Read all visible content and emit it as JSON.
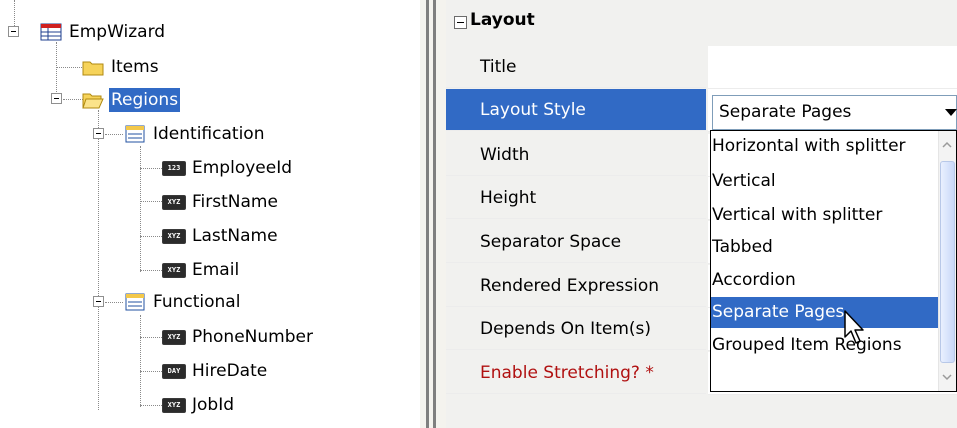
{
  "tree": {
    "root": {
      "label": "EmpWizard",
      "icon": "table-icon"
    },
    "items_node": {
      "label": "Items",
      "icon": "folder-icon"
    },
    "regions_node": {
      "label": "Regions",
      "icon": "open-folder-icon",
      "selected": true
    },
    "identification": {
      "label": "Identification",
      "icon": "region-icon",
      "children": [
        {
          "label": "EmployeeId",
          "badge": "123"
        },
        {
          "label": "FirstName",
          "badge": "XYZ"
        },
        {
          "label": "LastName",
          "badge": "XYZ"
        },
        {
          "label": "Email",
          "badge": "XYZ"
        }
      ]
    },
    "functional": {
      "label": "Functional",
      "icon": "region-icon",
      "children": [
        {
          "label": "PhoneNumber",
          "badge": "XYZ"
        },
        {
          "label": "HireDate",
          "badge": "DAY"
        },
        {
          "label": "JobId",
          "badge": "XYZ"
        }
      ]
    }
  },
  "grid": {
    "category": "Layout",
    "rows": [
      {
        "label": "Title"
      },
      {
        "label": "Layout Style",
        "selected": true
      },
      {
        "label": "Width"
      },
      {
        "label": "Height"
      },
      {
        "label": "Separator Space"
      },
      {
        "label": "Rendered Expression"
      },
      {
        "label": "Depends On Item(s)"
      },
      {
        "label": "Enable Stretching? *",
        "required": true
      }
    ]
  },
  "combo": {
    "value": "Separate Pages",
    "options": [
      "Horizontal with splitter",
      "Vertical",
      "Vertical with splitter",
      "Tabbed",
      "Accordion",
      "Separate Pages",
      "Grouped Item Regions"
    ],
    "selected_index": 5
  },
  "colors": {
    "selection": "#316ac5",
    "required_text": "#b01010"
  }
}
